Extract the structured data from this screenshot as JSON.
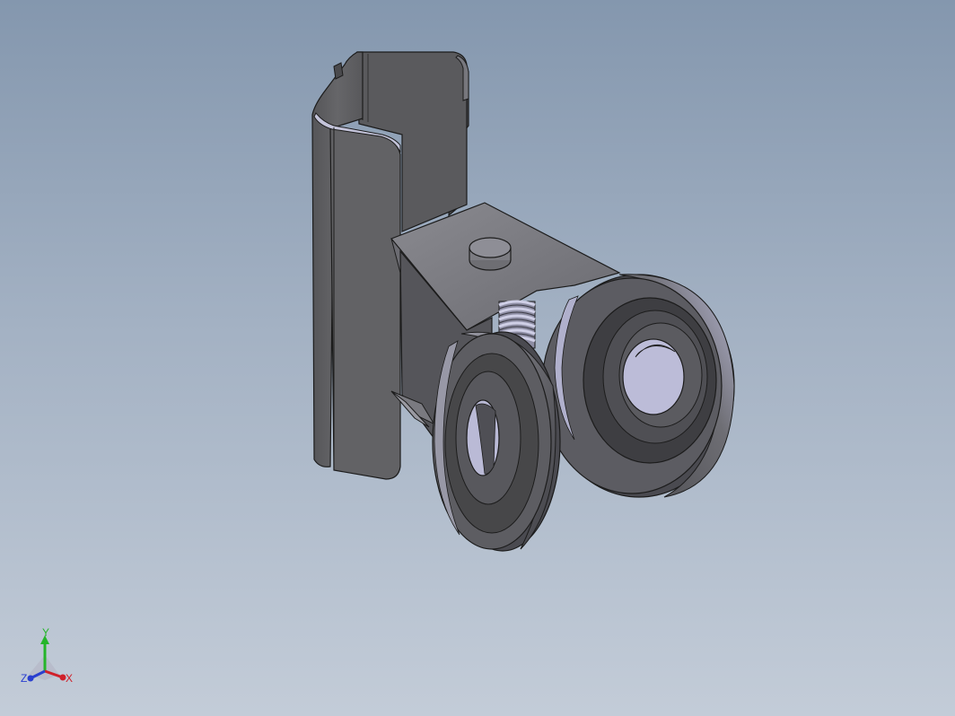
{
  "viewport": {
    "background_top": "#8497ae",
    "background_bottom": "#c3ccd8",
    "model": "sliding-door-roller-hanger",
    "render_style": "shaded-with-edges"
  },
  "colors": {
    "part_fill": "#5f5f5f",
    "part_dark": "#454545",
    "part_light": "#8d8d95",
    "highlight": "#b9b9d6",
    "edge": "#1c1c1c"
  },
  "triad": {
    "x_label": "X",
    "y_label": "Y",
    "z_label": "Z",
    "x_color": "#d0202a",
    "y_color": "#25b52a",
    "z_color": "#2a3fcf"
  }
}
